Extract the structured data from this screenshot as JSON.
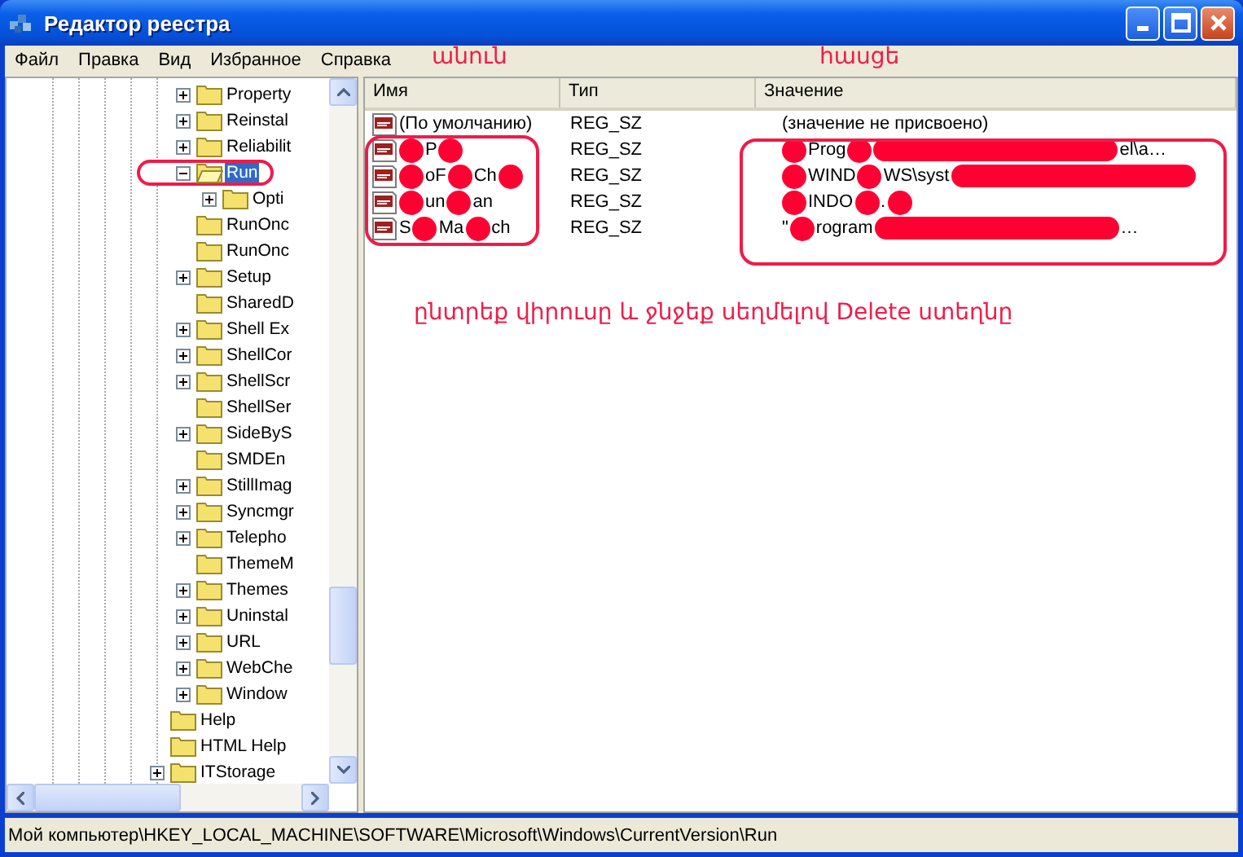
{
  "window": {
    "title": "Редактор реестра"
  },
  "menu": {
    "items": [
      "Файл",
      "Правка",
      "Вид",
      "Избранное",
      "Справка"
    ],
    "notes": [
      "անուն",
      "հասցե"
    ]
  },
  "tree": {
    "scrolled_branch": [
      {
        "label": "Property",
        "kind": "branch",
        "expanded": false,
        "selected": false,
        "circled": false
      },
      {
        "label": "Reinstal",
        "kind": "branch",
        "expanded": false,
        "selected": false,
        "circled": false
      },
      {
        "label": "Reliabilit",
        "kind": "branch",
        "expanded": false,
        "selected": false,
        "circled": false
      },
      {
        "label": "Run",
        "kind": "branch",
        "expanded": true,
        "selected": true,
        "circled": true,
        "children": [
          {
            "label": "Opti",
            "kind": "branch",
            "expanded": false,
            "selected": false,
            "circled": false
          }
        ]
      },
      {
        "label": "RunOnc",
        "kind": "leaf",
        "expanded": false,
        "selected": false,
        "circled": false
      },
      {
        "label": "RunOnc",
        "kind": "leaf",
        "expanded": false,
        "selected": false,
        "circled": false
      },
      {
        "label": "Setup",
        "kind": "branch",
        "expanded": false,
        "selected": false,
        "circled": false
      },
      {
        "label": "SharedD",
        "kind": "leaf",
        "expanded": false,
        "selected": false,
        "circled": false
      },
      {
        "label": "Shell Ex",
        "kind": "branch",
        "expanded": false,
        "selected": false,
        "circled": false
      },
      {
        "label": "ShellCor",
        "kind": "branch",
        "expanded": false,
        "selected": false,
        "circled": false
      },
      {
        "label": "ShellScr",
        "kind": "branch",
        "expanded": false,
        "selected": false,
        "circled": false
      },
      {
        "label": "ShellSer",
        "kind": "leaf",
        "expanded": false,
        "selected": false,
        "circled": false
      },
      {
        "label": "SideByS",
        "kind": "branch",
        "expanded": false,
        "selected": false,
        "circled": false
      },
      {
        "label": "SMDEn",
        "kind": "leaf",
        "expanded": false,
        "selected": false,
        "circled": false
      },
      {
        "label": "StillImag",
        "kind": "branch",
        "expanded": false,
        "selected": false,
        "circled": false
      },
      {
        "label": "Syncmgr",
        "kind": "branch",
        "expanded": false,
        "selected": false,
        "circled": false
      },
      {
        "label": "Telepho",
        "kind": "branch",
        "expanded": false,
        "selected": false,
        "circled": false
      },
      {
        "label": "ThemeM",
        "kind": "leaf",
        "expanded": false,
        "selected": false,
        "circled": false
      },
      {
        "label": "Themes",
        "kind": "branch",
        "expanded": false,
        "selected": false,
        "circled": false
      },
      {
        "label": "Uninstal",
        "kind": "branch",
        "expanded": false,
        "selected": false,
        "circled": false
      },
      {
        "label": "URL",
        "kind": "branch",
        "expanded": false,
        "selected": false,
        "circled": false
      },
      {
        "label": "WebChe",
        "kind": "branch",
        "expanded": false,
        "selected": false,
        "circled": false
      },
      {
        "label": "Window",
        "kind": "branch",
        "expanded": false,
        "selected": false,
        "circled": false
      }
    ],
    "items": [
      {
        "label": "Help",
        "kind": "leaf",
        "expanded": false,
        "selected": false,
        "circled": false
      },
      {
        "label": "HTML Help",
        "kind": "leaf",
        "expanded": false,
        "selected": false,
        "circled": false
      },
      {
        "label": "ITStorage",
        "kind": "branch",
        "expanded": false,
        "selected": false,
        "circled": false
      }
    ]
  },
  "table": {
    "columns": [
      "Имя",
      "Тип",
      "Значение"
    ],
    "rows": [
      {
        "circled": false,
        "name": [
          {
            "kind": "text",
            "text": "(По умолчанию)"
          }
        ],
        "type": "REG_SZ",
        "value": [
          {
            "kind": "text",
            "text": "(значение не присвоено)"
          }
        ]
      },
      {
        "circled": true,
        "name": [
          {
            "kind": "blob"
          },
          {
            "kind": "text",
            "text": "P"
          },
          {
            "kind": "blob"
          }
        ],
        "type": "REG_SZ",
        "value": [
          {
            "kind": "blob"
          },
          {
            "kind": "text",
            "text": "Prog"
          },
          {
            "kind": "blob"
          },
          {
            "kind": "bar"
          },
          {
            "kind": "text",
            "text": "el\\a…"
          }
        ]
      },
      {
        "circled": true,
        "name": [
          {
            "kind": "blob"
          },
          {
            "kind": "text",
            "text": "oF"
          },
          {
            "kind": "blob"
          },
          {
            "kind": "text",
            "text": "Ch"
          },
          {
            "kind": "blob"
          }
        ],
        "type": "REG_SZ",
        "value": [
          {
            "kind": "blob"
          },
          {
            "kind": "text",
            "text": "WIND"
          },
          {
            "kind": "blob"
          },
          {
            "kind": "text",
            "text": "WS\\syst"
          },
          {
            "kind": "bar"
          }
        ]
      },
      {
        "circled": true,
        "name": [
          {
            "kind": "blob"
          },
          {
            "kind": "text",
            "text": "un"
          },
          {
            "kind": "blob"
          },
          {
            "kind": "text",
            "text": "an"
          }
        ],
        "type": "REG_SZ",
        "value": [
          {
            "kind": "blob"
          },
          {
            "kind": "text",
            "text": "INDO"
          },
          {
            "kind": "blob"
          },
          {
            "kind": "text",
            "text": "."
          },
          {
            "kind": "blob"
          }
        ]
      },
      {
        "circled": true,
        "name": [
          {
            "kind": "text",
            "text": "S"
          },
          {
            "kind": "blob"
          },
          {
            "kind": "text",
            "text": "Ma"
          },
          {
            "kind": "blob"
          },
          {
            "kind": "text",
            "text": "ch"
          }
        ],
        "type": "REG_SZ",
        "value": [
          {
            "kind": "text",
            "text": "\""
          },
          {
            "kind": "blob"
          },
          {
            "kind": "text",
            "text": "rogram"
          },
          {
            "kind": "bar"
          },
          {
            "kind": "text",
            "text": "…"
          }
        ]
      }
    ]
  },
  "instruction": "ընտրեք վիրուսը և ջնջեք սեղմելով Delete ստեղնը",
  "status_bar": "Мой компьютер\\HKEY_LOCAL_MACHINE\\SOFTWARE\\Microsoft\\Windows\\CurrentVersion\\Run"
}
